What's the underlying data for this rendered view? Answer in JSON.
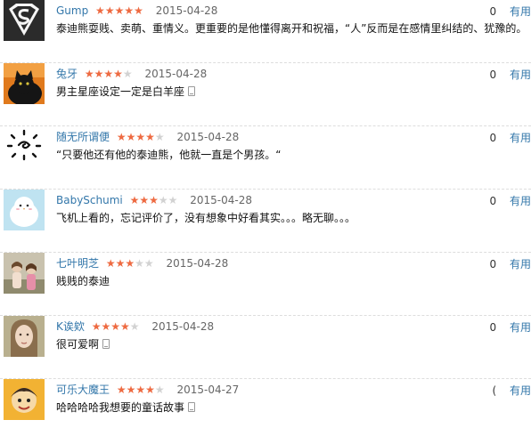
{
  "useful_label": "有用",
  "reviews": [
    {
      "user": "Gump",
      "rating": 5,
      "date": "2015-04-28",
      "votes": "0",
      "comment": "泰迪熊耍贱、卖萌、重情义。更重要的是他懂得离开和祝福，“人”反而是在感情里纠结的、犹豫的。",
      "mobile": false,
      "avatar_icon": "superman-logo-avatar"
    },
    {
      "user": "兔牙",
      "rating": 4,
      "date": "2015-04-28",
      "votes": "0",
      "comment": "男主星座设定一定是白羊座",
      "mobile": true,
      "avatar_icon": "black-cat-avatar"
    },
    {
      "user": "随无所谓便",
      "rating": 4,
      "date": "2015-04-28",
      "votes": "0",
      "comment": "“只要他还有他的泰迪熊，他就一直是个男孩。“",
      "mobile": false,
      "avatar_icon": "sun-doodle-avatar"
    },
    {
      "user": "BabySchumi",
      "rating": 3,
      "date": "2015-04-28",
      "votes": "0",
      "comment": "飞机上看的，忘记评价了，没有想象中好看其实。。。略无聊。。。",
      "mobile": false,
      "avatar_icon": "white-bird-avatar"
    },
    {
      "user": "七叶明芝",
      "rating": 3,
      "date": "2015-04-28",
      "votes": "0",
      "comment": "贱贱的泰迪",
      "mobile": false,
      "avatar_icon": "children-photo-avatar"
    },
    {
      "user": "K诶欸",
      "rating": 4,
      "date": "2015-04-28",
      "votes": "0",
      "comment": "很可爱啊",
      "mobile": true,
      "avatar_icon": "girl-portrait-avatar"
    },
    {
      "user": "可乐大魔王",
      "rating": 4,
      "date": "2015-04-27",
      "votes": "(",
      "comment": "哈哈哈哈我想要的童话故事",
      "mobile": true,
      "avatar_icon": "cartoon-character-avatar"
    }
  ],
  "colors": {
    "link": "#3377aa",
    "star_on": "#ee6a41",
    "star_off": "#d2d2d2"
  }
}
